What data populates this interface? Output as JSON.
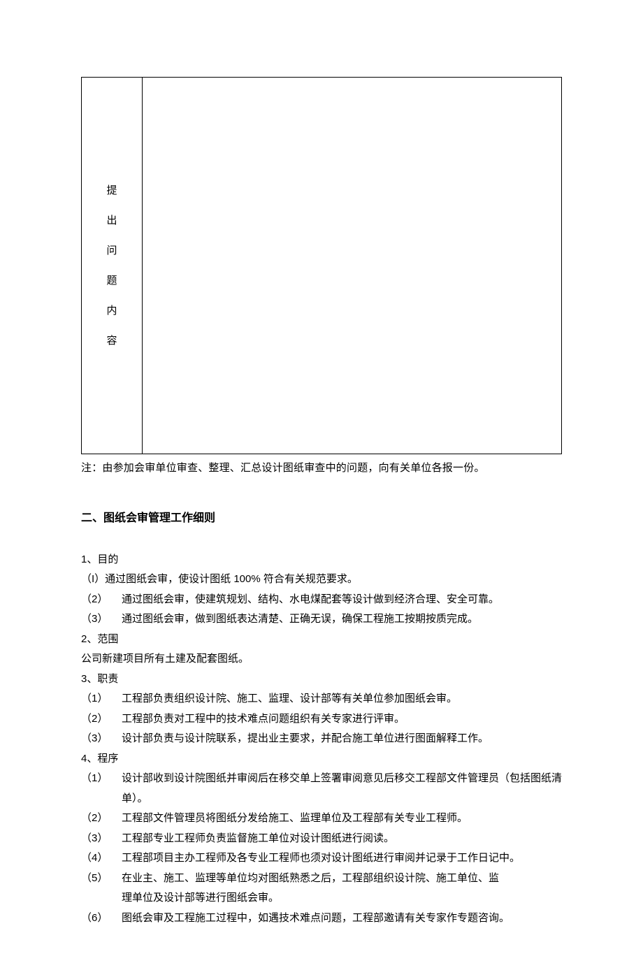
{
  "table": {
    "label_c1": "提",
    "label_c2": "出",
    "label_c3": "问",
    "label_c4": "题",
    "label_c5": "内",
    "label_c6": "容"
  },
  "note": "注：由参加会审单位审查、整理、汇总设计图纸审查中的问题，向有关单位各报一份。",
  "section2": {
    "heading": "二、图纸会审管理工作细则",
    "p1_label": "1、目的",
    "p1_1": "（I）通过图纸会审，使设计图纸 100% 符合有关规范要求。",
    "p1_2_num": "（2）",
    "p1_2_text": "通过图纸会审，使建筑规划、结构、水电煤配套等设计做到经济合理、安全可靠。",
    "p1_3_num": "（3）",
    "p1_3_text": "通过图纸会审，做到图纸表达清楚、正确无误，确保工程施工按期按质完成。",
    "p2_label": "2、范围",
    "p2_text": "公司新建项目所有土建及配套图纸。",
    "p3_label": "3、职责",
    "p3_1_num": "（1）",
    "p3_1_text": "工程部负责组织设计院、施工、监理、设计部等有关单位参加图纸会审。",
    "p3_2_num": "（2）",
    "p3_2_text": "工程部负责对工程中的技术难点问题组织有关专家进行评审。",
    "p3_3_num": "（3）",
    "p3_3_text": "设计部负责与设计院联系，提出业主要求，并配合施工单位进行图面解释工作。",
    "p4_label": "4、程序",
    "p4_1_num": "（1）",
    "p4_1_text": "设计部收到设计院图纸并审阅后在移交单上签署审阅意见后移交工程部文件管理员（包括图纸清单）。",
    "p4_2_num": "（2）",
    "p4_2_text": "工程部文件管理员将图纸分发给施工、监理单位及工程部有关专业工程师。",
    "p4_3_num": "（3）",
    "p4_3_text": "工程部专业工程师负责监督施工单位对设计图纸进行阅读。",
    "p4_4_num": "（4）",
    "p4_4_text": "工程部项目主办工程师及各专业工程师也须对设计图纸进行审阅并记录于工作日记中。",
    "p4_5_num": "（5）",
    "p4_5_text_line1": "在业主、施工、监理等单位均对图纸熟悉之后，工程部组织设计院、施工单位、监",
    "p4_5_text_line2": "理单位及设计部等进行图纸会审。",
    "p4_6_num": "（6）",
    "p4_6_text": "图纸会审及工程施工过程中，如遇技术难点问题，工程部邀请有关专家作专题咨询。"
  }
}
